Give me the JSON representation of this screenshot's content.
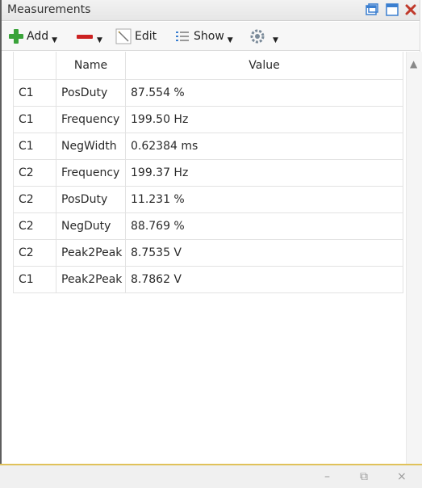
{
  "window": {
    "title": "Measurements"
  },
  "icons": {
    "restore": "restore-window-icon",
    "maximize": "maximize-icon",
    "close": "close-icon",
    "add": "plus-icon",
    "remove": "minus-icon",
    "edit": "edit-icon",
    "show": "list-icon",
    "settings": "gear-icon"
  },
  "colors": {
    "close": "#c0392b",
    "add": "#3aa33a",
    "remove": "#cc2222",
    "window_btn": "#3b7fd0"
  },
  "toolbar": {
    "add_label": "Add",
    "edit_label": "Edit",
    "show_label": "Show"
  },
  "table": {
    "headers": [
      "",
      "Name",
      "Value"
    ],
    "rows": [
      [
        "C1",
        "PosDuty",
        "87.554 %"
      ],
      [
        "C1",
        "Frequency",
        "199.50 Hz"
      ],
      [
        "C1",
        "NegWidth",
        "0.62384 ms"
      ],
      [
        "C2",
        "Frequency",
        "199.37 Hz"
      ],
      [
        "C2",
        "PosDuty",
        "11.231 %"
      ],
      [
        "C2",
        "NegDuty",
        "88.769 %"
      ],
      [
        "C2",
        "Peak2Peak",
        "8.7535 V"
      ],
      [
        "C1",
        "Peak2Peak",
        "8.7862 V"
      ]
    ]
  },
  "bottom_bar": {
    "minimize": "–",
    "restore": "⧉",
    "close": "×"
  }
}
